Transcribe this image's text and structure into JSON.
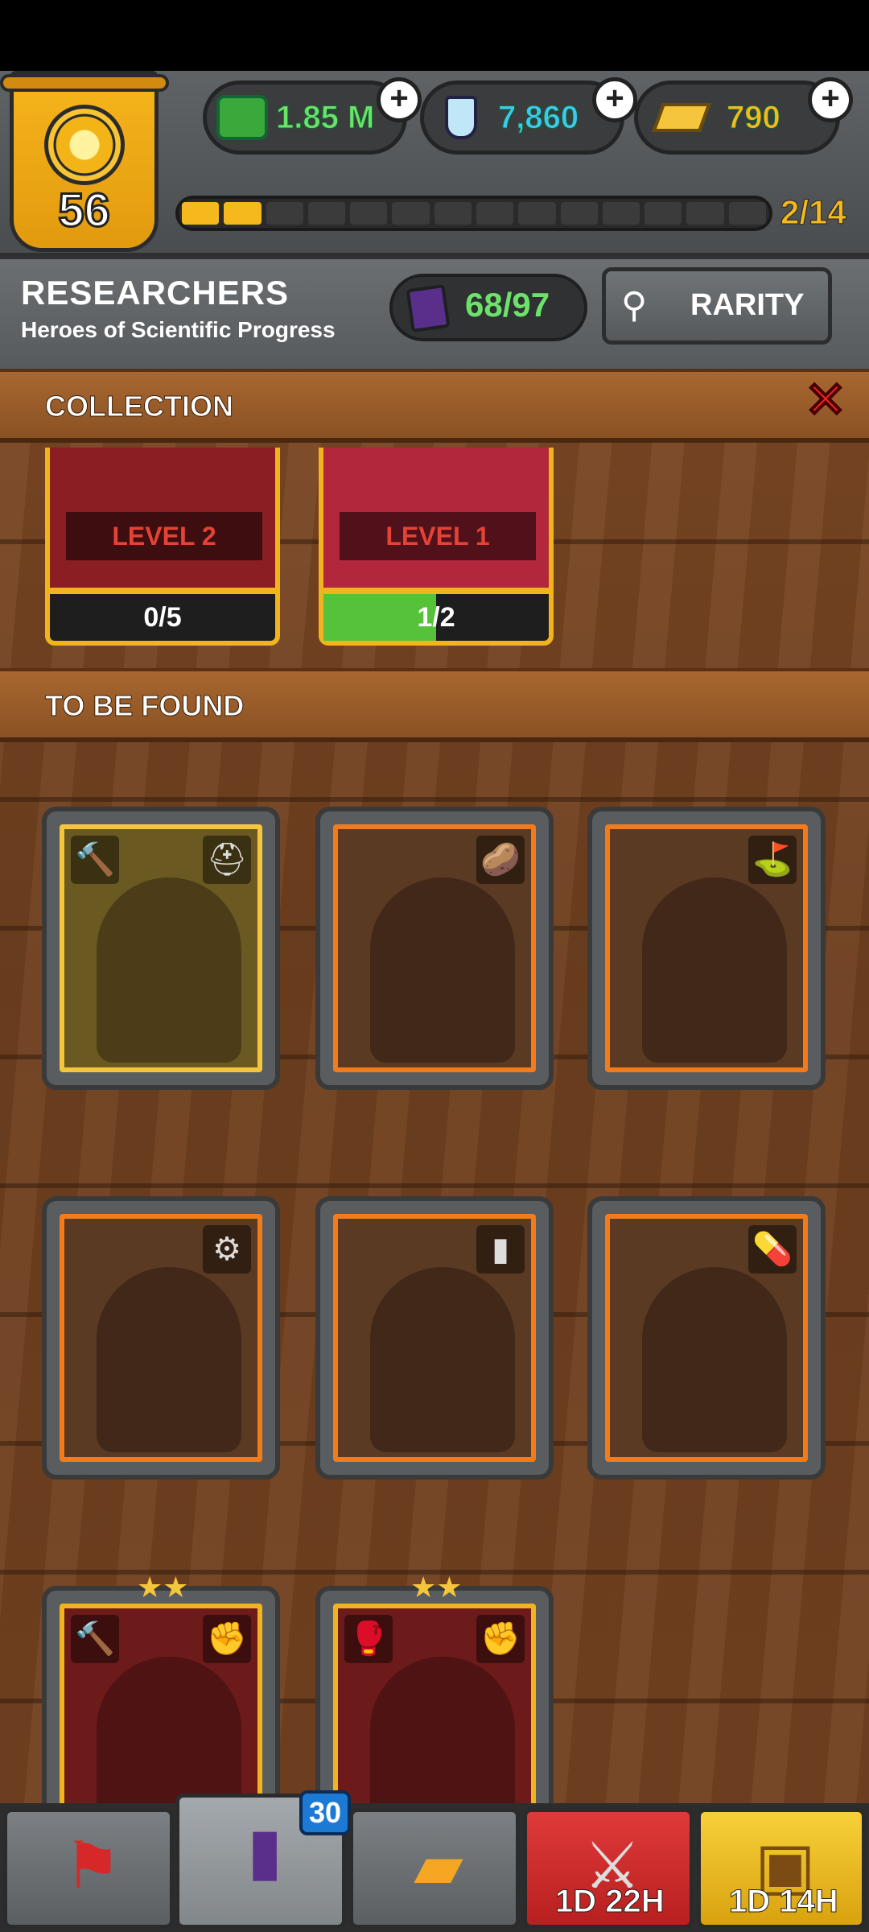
{
  "header": {
    "level": "56",
    "resources": {
      "cash": "1.85 M",
      "science": "7,860",
      "gold": "790"
    },
    "progress_text": "2/14",
    "progress_fraction": 0.14
  },
  "category": {
    "title": "RESEARCHERS",
    "subtitle": "Heroes of Scientific Progress",
    "count": "68/97",
    "rarity_label": "RARITY"
  },
  "sections": {
    "collection": "COLLECTION",
    "to_be_found": "TO BE FOUND"
  },
  "collection_cards": [
    {
      "level": "LEVEL 2",
      "progress": "0/5",
      "fill": 0.0
    },
    {
      "level": "LEVEL 1",
      "progress": "1/2",
      "fill": 0.5
    }
  ],
  "unfound_cards": [
    {
      "icon": "hammer-icon",
      "icon2": "miner-helmet-icon",
      "frame": "gold"
    },
    {
      "icon": "potato-icon",
      "frame": "orange"
    },
    {
      "icon": "golf-icon",
      "frame": "orange"
    },
    {
      "icon": "gear-icon",
      "frame": "orange"
    },
    {
      "icon": "ammo-icon",
      "frame": "orange"
    },
    {
      "icon": "pill-icon",
      "frame": "orange"
    },
    {
      "icon": "hammer-icon",
      "icon2": "fist-icon",
      "frame": "red"
    },
    {
      "icon": "boxing-glove-icon",
      "icon2": "fist-icon",
      "frame": "red"
    }
  ],
  "navbar": {
    "cards_badge": "30",
    "timer_1": "1D 22H",
    "timer_2": "1D 14H"
  },
  "colors": {
    "cash_text": "#6de26a",
    "science_text": "#3ec8f0",
    "gold_text": "#f5b81d",
    "close": "#e22222"
  }
}
